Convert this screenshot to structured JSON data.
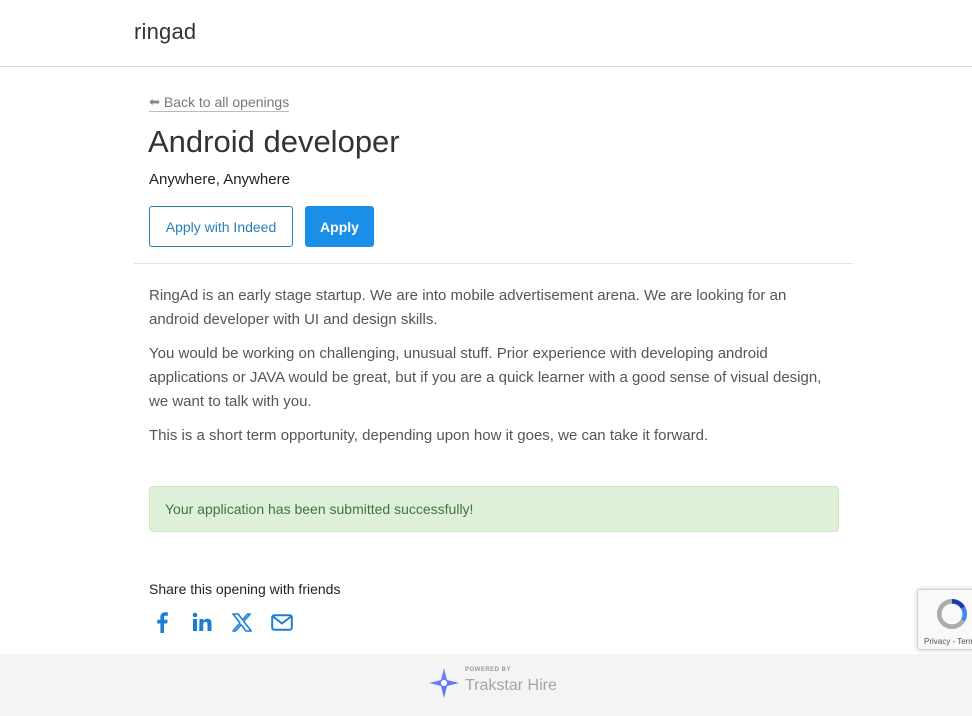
{
  "header": {
    "brand": "ringad"
  },
  "job": {
    "back_label": "Back to all openings",
    "title": "Android developer",
    "location": "Anywhere, Anywhere",
    "apply_indeed_label": "Apply with Indeed",
    "apply_label": "Apply",
    "description": [
      "RingAd is an early stage startup. We are into mobile advertisement arena. We are looking for an android developer with UI and design skills.",
      "You would be working on challenging, unusual stuff. Prior experience with developing android applications or JAVA would be great, but if you are a quick learner with a good sense of visual design, we want to talk with you.",
      "This is a short term opportunity, depending upon how it goes, we can take it forward."
    ]
  },
  "alert": {
    "message": "Your application has been submitted successfully!"
  },
  "share": {
    "title": "Share this opening with friends",
    "icons": [
      "facebook-icon",
      "linkedin-icon",
      "x-icon",
      "email-icon"
    ]
  },
  "recaptcha": {
    "terms": "Privacy - Terms"
  },
  "footer": {
    "powered_by": "POWERED BY",
    "product": "Trakstar Hire"
  },
  "colors": {
    "accent": "#1a8fe8",
    "outline_button": "#2a7fb8",
    "share_icons": "#1a7fd4",
    "success_bg": "#dff0d8",
    "success_text": "#3c763d"
  }
}
